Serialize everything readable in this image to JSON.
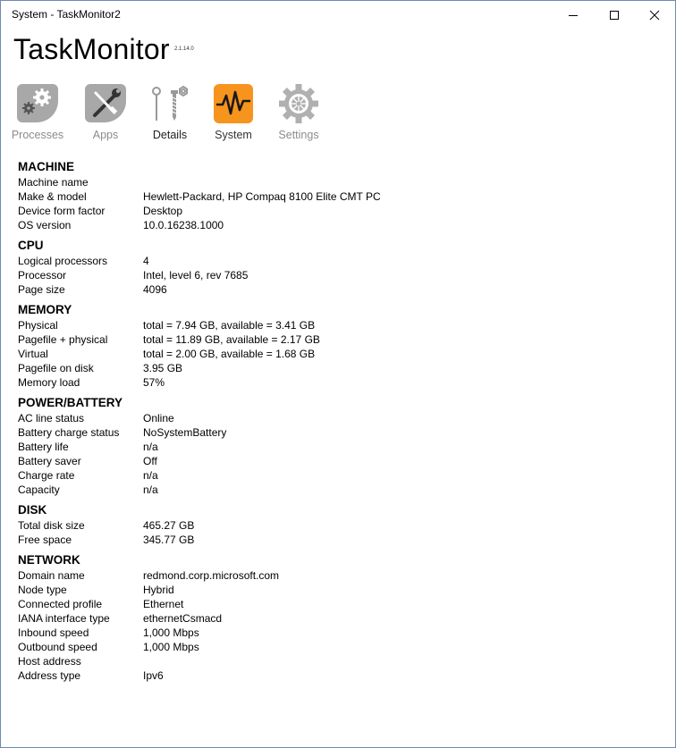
{
  "window": {
    "title": "System - TaskMonitor2"
  },
  "app": {
    "name": "TaskMonitor",
    "version": "2.1.14.0"
  },
  "nav": [
    {
      "label": "Processes",
      "icon": "gears-icon",
      "state": "dim"
    },
    {
      "label": "Apps",
      "icon": "tools-icon",
      "state": "dim"
    },
    {
      "label": "Details",
      "icon": "nuts-bolts-icon",
      "state": "normal"
    },
    {
      "label": "System",
      "icon": "pulse-icon",
      "state": "active"
    },
    {
      "label": "Settings",
      "icon": "gear-icon",
      "state": "dim"
    }
  ],
  "colors": {
    "accent": "#f7941d",
    "dim_icon": "#a6a6a6"
  },
  "sections": [
    {
      "title": "MACHINE",
      "rows": [
        {
          "k": "Machine name",
          "v": ""
        },
        {
          "k": "Make & model",
          "v": "Hewlett-Packard, HP Compaq 8100 Elite CMT PC"
        },
        {
          "k": "Device form factor",
          "v": "Desktop"
        },
        {
          "k": "OS version",
          "v": "10.0.16238.1000"
        }
      ]
    },
    {
      "title": "CPU",
      "rows": [
        {
          "k": "Logical processors",
          "v": "4"
        },
        {
          "k": "Processor",
          "v": "Intel, level 6, rev 7685"
        },
        {
          "k": "Page size",
          "v": "4096"
        }
      ]
    },
    {
      "title": "MEMORY",
      "rows": [
        {
          "k": "Physical",
          "v": "total = 7.94 GB, available = 3.41 GB"
        },
        {
          "k": "Pagefile + physical",
          "v": "total = 11.89 GB, available = 2.17 GB"
        },
        {
          "k": "Virtual",
          "v": "total = 2.00 GB, available = 1.68 GB"
        },
        {
          "k": "Pagefile on disk",
          "v": "3.95 GB"
        },
        {
          "k": "Memory load",
          "v": "57%"
        }
      ]
    },
    {
      "title": "POWER/BATTERY",
      "rows": [
        {
          "k": "AC line status",
          "v": "Online"
        },
        {
          "k": "Battery charge status",
          "v": "NoSystemBattery"
        },
        {
          "k": "Battery life",
          "v": "n/a"
        },
        {
          "k": "Battery saver",
          "v": "Off"
        },
        {
          "k": "Charge rate",
          "v": "n/a"
        },
        {
          "k": "Capacity",
          "v": "n/a"
        }
      ]
    },
    {
      "title": "DISK",
      "rows": [
        {
          "k": "Total disk size",
          "v": "465.27 GB"
        },
        {
          "k": "Free space",
          "v": "345.77 GB"
        }
      ]
    },
    {
      "title": "NETWORK",
      "rows": [
        {
          "k": "Domain name",
          "v": "redmond.corp.microsoft.com"
        },
        {
          "k": "Node type",
          "v": "Hybrid"
        },
        {
          "k": "Connected profile",
          "v": "Ethernet"
        },
        {
          "k": "IANA interface type",
          "v": "ethernetCsmacd"
        },
        {
          "k": "Inbound speed",
          "v": "1,000 Mbps"
        },
        {
          "k": "Outbound speed",
          "v": "1,000 Mbps"
        },
        {
          "k": "Host address",
          "v": ""
        },
        {
          "k": "Address type",
          "v": "Ipv6"
        }
      ]
    }
  ]
}
